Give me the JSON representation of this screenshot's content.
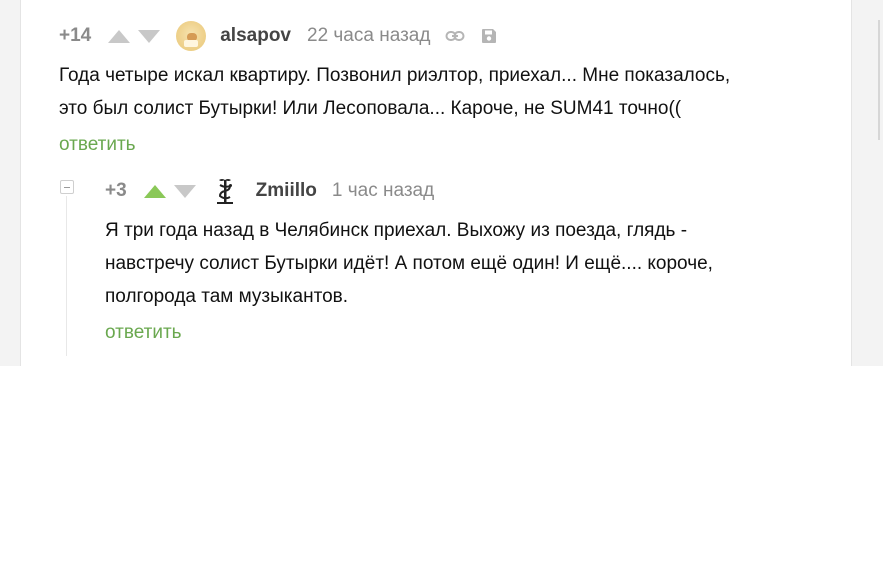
{
  "comment1": {
    "rating": "+14",
    "username": "alsapov",
    "time": "22 часа назад",
    "icons": [
      "arrow-up-icon",
      "arrow-down-icon",
      "link-icon",
      "save-icon"
    ],
    "lines": [
      "Года четыре искал квартиру. Позвонил риэлтор, приехал... Мне показалось,",
      "это был солист Бутырки! Или Лесоповала... Кароче, не SUM41 точно(("
    ],
    "reply_label": "ответить"
  },
  "comment2": {
    "rating": "+3",
    "username": "Zmiillo",
    "time": "1 час назад",
    "upvoted": true,
    "avatar_icon": "caduceus-icon",
    "lines": [
      "Я три года назад в Челябинск приехал. Выхожу из поезда, глядь -",
      "навстречу солист Бутырки идёт! А потом ещё один! И ещё.... короче,",
      "полгорода там музыкантов."
    ],
    "reply_label": "ответить"
  },
  "colors": {
    "accent_green": "#8ac858",
    "link_green": "#6aa84f",
    "muted_gray": "#8a8a8a"
  }
}
